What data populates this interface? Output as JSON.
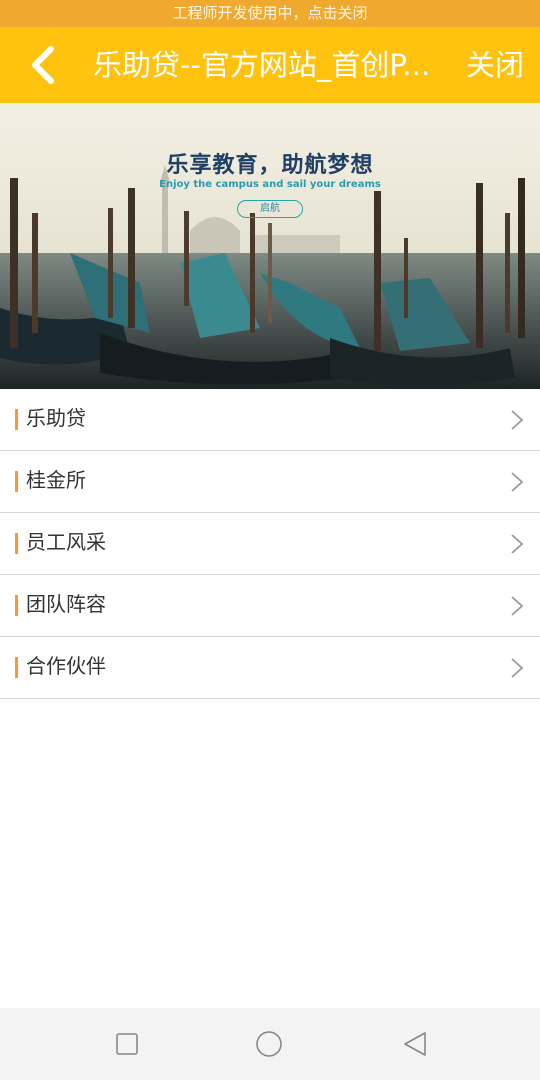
{
  "dev_banner": {
    "text": "工程师开发使用中，点击关闭"
  },
  "header": {
    "title": "乐助贷--官方网站_首创P...",
    "close_label": "关闭"
  },
  "banner": {
    "title": "乐享教育，助航梦想",
    "subtitle": "Enjoy the campus and sail your dreams",
    "button_label": "启航"
  },
  "menu": {
    "items": [
      {
        "label": "乐助贷"
      },
      {
        "label": "桂金所"
      },
      {
        "label": "员工风采"
      },
      {
        "label": "团队阵容"
      },
      {
        "label": "合作伙伴"
      }
    ]
  },
  "colors": {
    "accent": "#ffc20e",
    "banner_bg": "#f0a92f",
    "menu_bar": "#f39a3c"
  },
  "icons": {
    "back": "chevron-left-icon",
    "item_arrow": "chevron-right-icon",
    "nav_recent": "square-icon",
    "nav_home": "circle-icon",
    "nav_back": "triangle-back-icon"
  }
}
